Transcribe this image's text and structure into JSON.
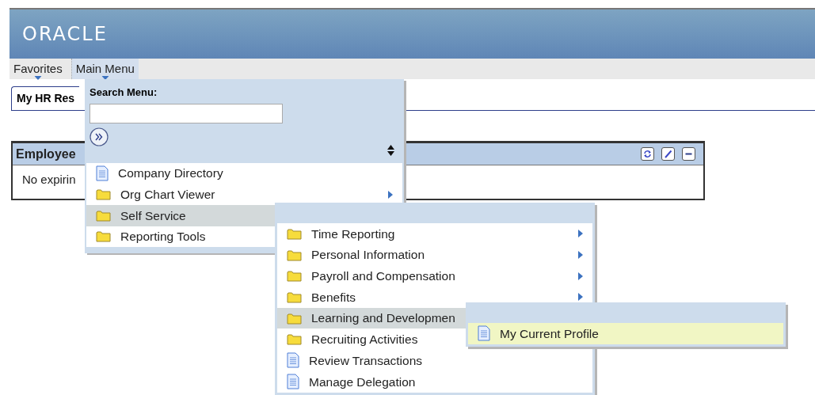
{
  "header": {
    "logo": "ORACLE"
  },
  "menubar": [
    {
      "label": "Favorites",
      "selected": false
    },
    {
      "label": "Main Menu",
      "selected": true
    }
  ],
  "tab": {
    "label": "My HR Res"
  },
  "pagelet": {
    "title": "Employee",
    "body": "No expirin"
  },
  "main_menu": {
    "search_label": "Search Menu:",
    "items": [
      {
        "label": "Company Directory",
        "kind": "page",
        "has_submenu": false,
        "selected": false
      },
      {
        "label": "Org Chart Viewer",
        "kind": "folder",
        "has_submenu": true,
        "selected": false
      },
      {
        "label": "Self Service",
        "kind": "folder",
        "selected": true
      },
      {
        "label": "Reporting Tools",
        "kind": "folder",
        "selected": false
      }
    ]
  },
  "submenus": [
    {
      "items": [
        {
          "label": "Time Reporting",
          "kind": "folder",
          "has_submenu": true,
          "selected": false
        },
        {
          "label": "Personal Information",
          "kind": "folder",
          "has_submenu": true,
          "selected": false
        },
        {
          "label": "Payroll and Compensation",
          "kind": "folder",
          "has_submenu": true,
          "selected": false
        },
        {
          "label": "Benefits",
          "kind": "folder",
          "has_submenu": true,
          "selected": false
        },
        {
          "label": "Learning and Developmen",
          "kind": "folder",
          "selected": true
        },
        {
          "label": "Recruiting Activities",
          "kind": "folder",
          "selected": false
        },
        {
          "label": "Review Transactions",
          "kind": "page",
          "has_submenu": false,
          "selected": false
        },
        {
          "label": "Manage Delegation",
          "kind": "page",
          "has_submenu": false,
          "selected": false
        }
      ]
    },
    {
      "items": [
        {
          "label": "My Current Profile",
          "kind": "page",
          "has_submenu": false,
          "selected": true,
          "highlight": true
        }
      ]
    }
  ]
}
